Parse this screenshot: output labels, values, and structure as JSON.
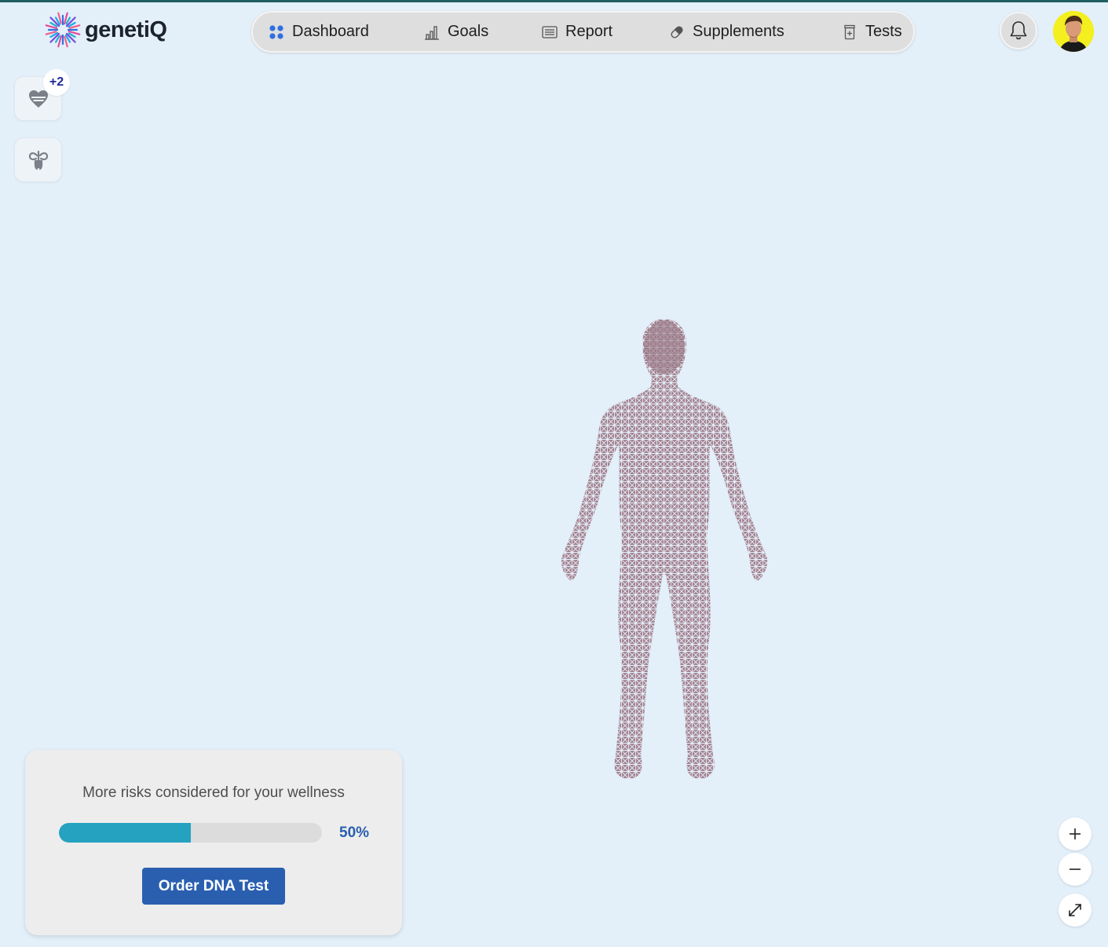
{
  "header": {
    "brand": "genetiQ",
    "nav": [
      {
        "label": "Dashboard",
        "icon": "dashboard-dots-icon"
      },
      {
        "label": "Goals",
        "icon": "bar-chart-icon"
      },
      {
        "label": "Report",
        "icon": "report-list-icon"
      },
      {
        "label": "Supplements",
        "icon": "pill-icon"
      },
      {
        "label": "Tests",
        "icon": "test-jar-icon"
      }
    ],
    "notifications_icon": "bell-icon",
    "avatar_bg": "#f4ef1f"
  },
  "sidebar": {
    "heart_button": {
      "icon": "heart-icon",
      "badge": "+2"
    },
    "organ_button": {
      "icon": "lungs-icon"
    }
  },
  "viewer": {
    "model": "human-body-wireframe",
    "model_color": "#a58391"
  },
  "risk_card": {
    "text": "More risks considered for your wellness",
    "progress_percent": 50,
    "progress_label": "50%",
    "progress_color": "#25a2c0",
    "button_label": "Order DNA Test",
    "button_color": "#2a5fb0"
  },
  "zoom_controls": [
    {
      "icon": "plus-icon"
    },
    {
      "icon": "minus-icon"
    },
    {
      "icon": "expand-icon"
    }
  ]
}
